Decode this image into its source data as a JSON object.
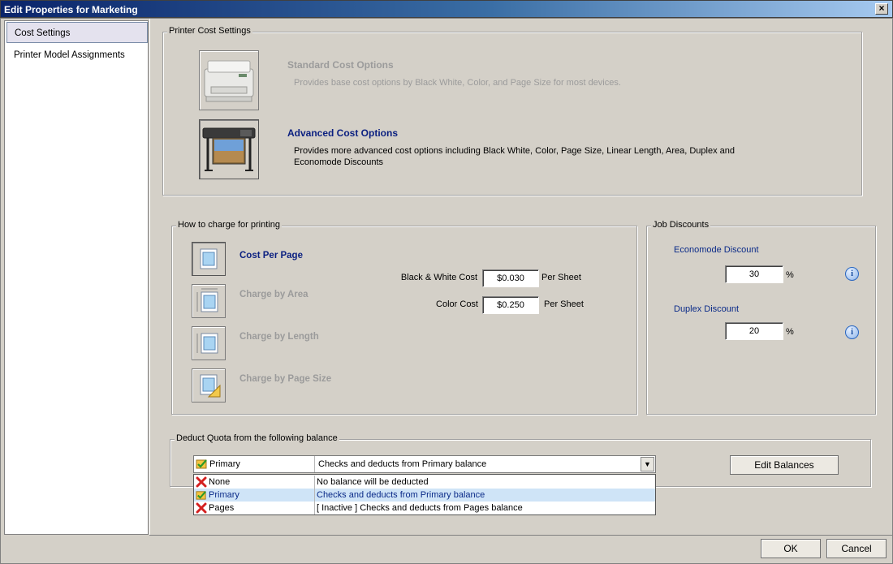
{
  "window": {
    "title": "Edit Properties for Marketing",
    "close_glyph": "×"
  },
  "sidebar": {
    "items": [
      {
        "label": "Cost Settings",
        "selected": true
      },
      {
        "label": "Printer Model Assignments",
        "selected": false
      }
    ]
  },
  "printer_cost_settings": {
    "legend": "Printer Cost Settings",
    "standard": {
      "title": "Standard Cost Options",
      "description": "Provides base cost options by Black  White, Color, and Page Size for most devices.",
      "icon": "laser-printer-icon",
      "selected": false
    },
    "advanced": {
      "title": "Advanced Cost Options",
      "description_line1": "Provides more advanced cost options including Black  White, Color, Page Size, Linear Length, Area, Duplex and",
      "description_line2": "Economode Discounts",
      "icon": "wide-format-printer-icon",
      "selected": true
    }
  },
  "how_to_charge": {
    "legend": "How to charge for printing",
    "options": [
      {
        "label": "Cost Per Page",
        "icon": "page-icon",
        "selected": true
      },
      {
        "label": "Charge by Area",
        "icon": "area-icon",
        "selected": false
      },
      {
        "label": "Charge by Length",
        "icon": "length-icon",
        "selected": false
      },
      {
        "label": "Charge by Page Size",
        "icon": "page-size-icon",
        "selected": false
      }
    ],
    "bw_cost_label": "Black & White Cost",
    "bw_cost_value": "$0.030",
    "bw_unit": "Per Sheet",
    "color_cost_label": "Color Cost",
    "color_cost_value": "$0.250",
    "color_unit": "Per Sheet"
  },
  "job_discounts": {
    "legend": "Job Discounts",
    "economode_label": "Economode Discount",
    "economode_value": "30",
    "duplex_label": "Duplex Discount",
    "duplex_value": "20",
    "percent": "%",
    "info_glyph": "i"
  },
  "deduct_quota": {
    "legend": "Deduct Quota from the following balance",
    "selected": {
      "name": "Primary",
      "description": "Checks and deducts from Primary balance",
      "status": "active"
    },
    "dropdown_arrow": "▼",
    "options": [
      {
        "name": "None",
        "description": "No balance will be deducted",
        "status": "inactive",
        "highlighted": false
      },
      {
        "name": "Primary",
        "description": "Checks and deducts from Primary balance",
        "status": "active",
        "highlighted": true
      },
      {
        "name": "Pages",
        "description": "[ Inactive ] Checks and deducts from Pages balance",
        "status": "inactive",
        "highlighted": false
      }
    ],
    "edit_balances_label": "Edit Balances"
  },
  "footer": {
    "ok_label": "OK",
    "cancel_label": "Cancel"
  },
  "colors": {
    "accent_title": "#0a1f80",
    "highlight_row": "#cfe4f7",
    "disabled_text": "#9b9b9b"
  }
}
